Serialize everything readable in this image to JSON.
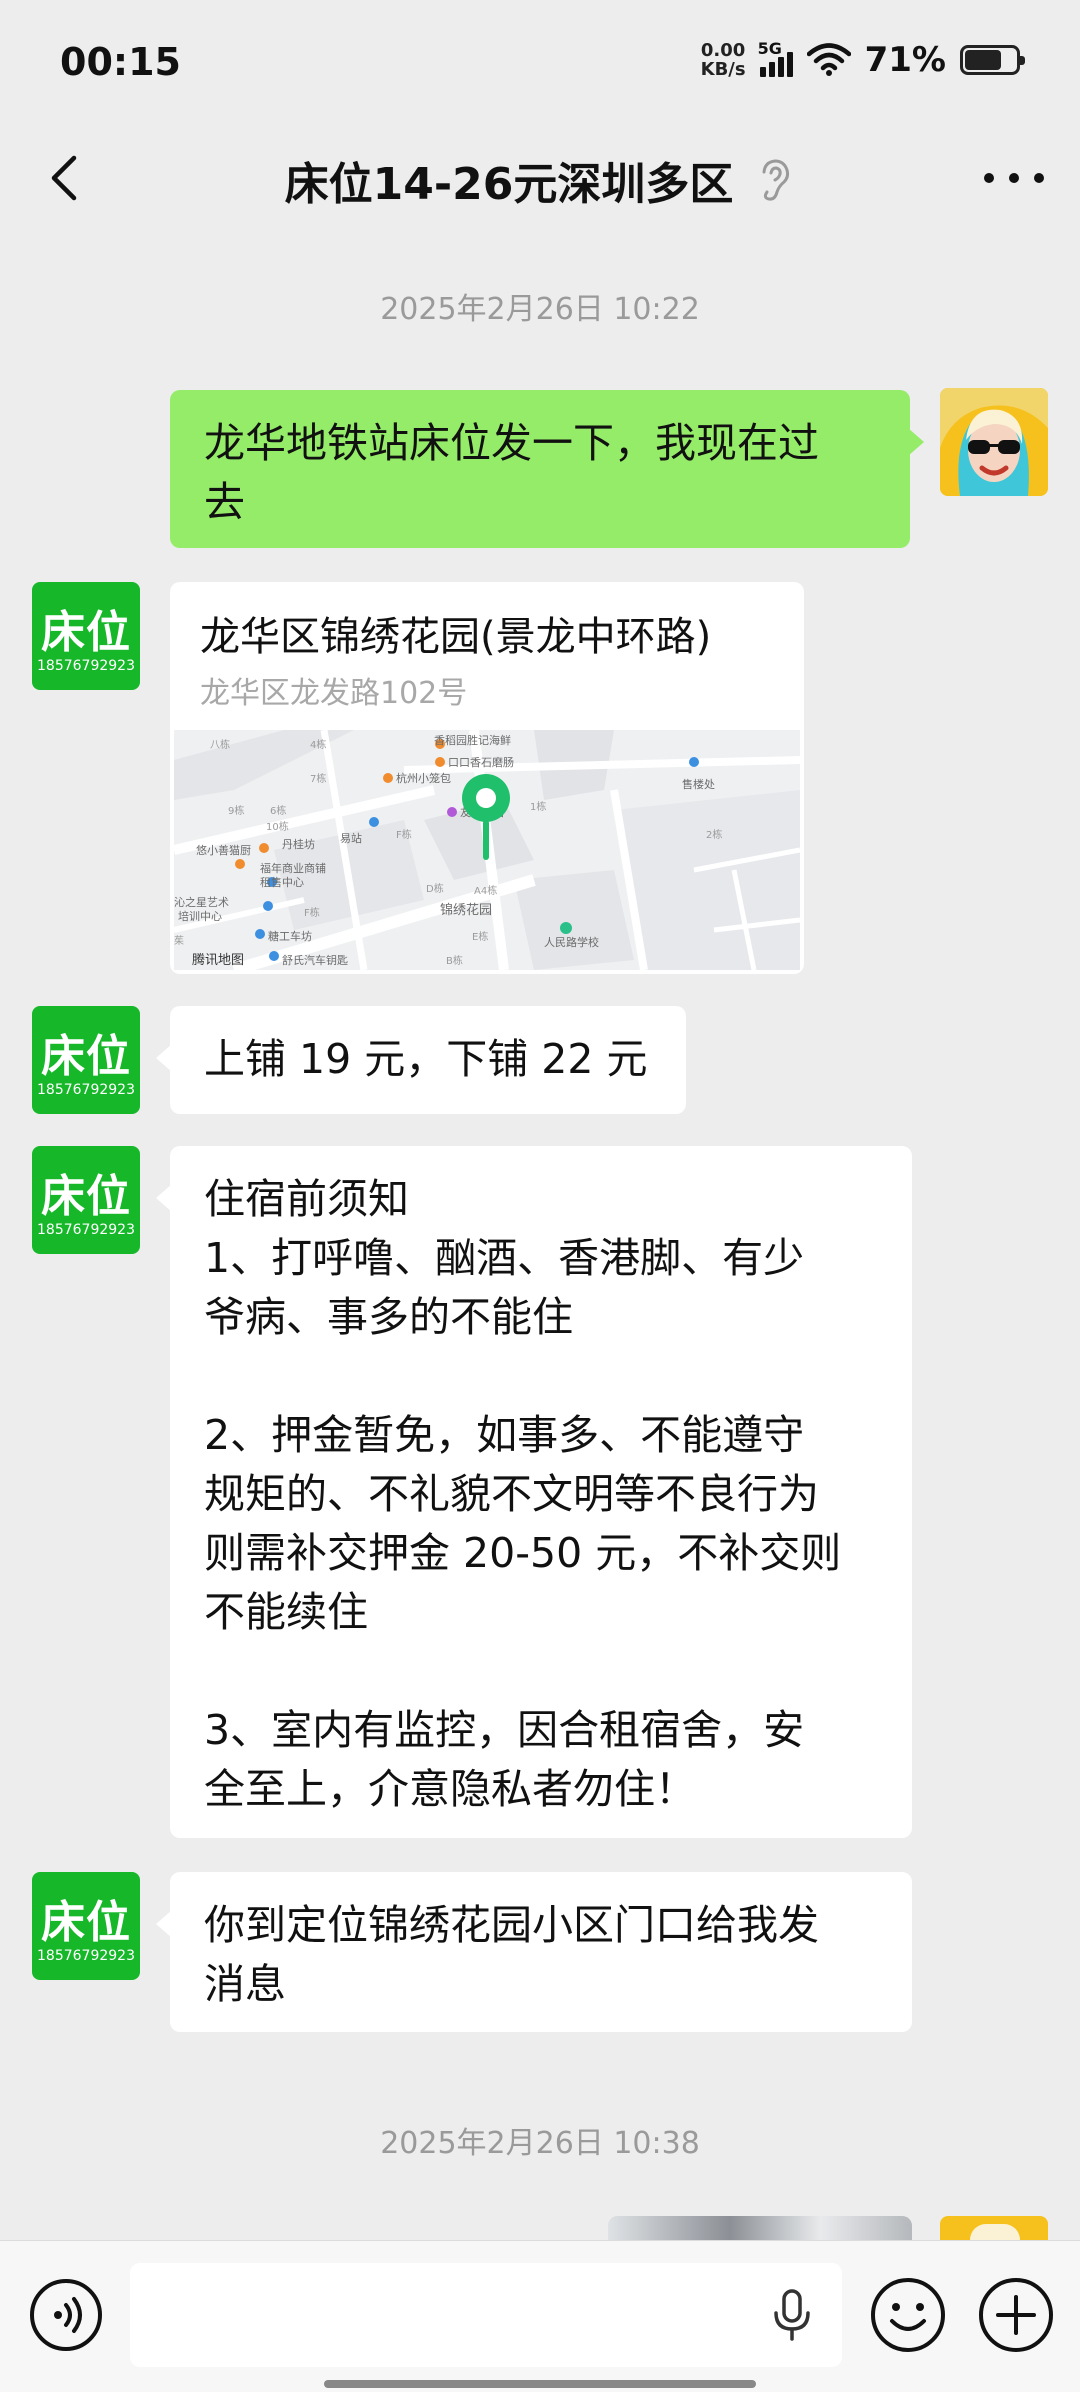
{
  "status_bar": {
    "time": "00:15",
    "net_speed_value": "0.00",
    "net_speed_unit": "KB/s",
    "network": "5G",
    "battery": "71%",
    "battery_level": 0.71
  },
  "header": {
    "title": "床位14-26元深圳多区"
  },
  "messages": {
    "timestamp_1": "2025年2月26日 10:22",
    "out_1": "龙华地铁站床位发一下，我现在过\n去",
    "contact_avatar_label": "床位",
    "contact_avatar_phone": "18576792923",
    "location_name": "龙华区锦绣花园(景龙中环路)",
    "location_address": "龙华区龙发路102号",
    "map_labels": {
      "l1": "香稻园胜记海鲜",
      "l2": "口口香石磨肠",
      "l3": "杭州小笼包",
      "l4": "友佳宾馆",
      "l5": "易站",
      "l6": "丹桂坊",
      "l7": "悠小善猫厨",
      "l8": "福年商业商铺",
      "l9": "租售中心",
      "l10": "沁之星艺术",
      "l11": "培训中心",
      "l12": "糖工车坊",
      "l13": "舒氏汽车钥匙",
      "l14": "锦绣花园",
      "l15": "人民路学校",
      "l16": "售楼处",
      "l17": "腾讯地图",
      "b1": "八栋",
      "b2": "4栋",
      "b3": "7栋",
      "b4": "6栋",
      "b5": "9栋",
      "b6": "10栋",
      "b7": "F栋",
      "b8": "D栋",
      "b9": "A4栋",
      "b10": "E栋",
      "b11": "1栋",
      "b12": "2栋",
      "b13": "B栋",
      "b14": "F栋",
      "b15": "茱"
    },
    "in_price": "上铺 19 元，下铺 22 元",
    "in_notice": "住宿前须知\n1、打呼噜、酗酒、香港脚、有少\n爷病、事多的不能住\n\n2、押金暂免，如事多、不能遵守\n规矩的、不礼貌不文明等不良行为\n则需补交押金 20-50 元，不补交则\n不能续住\n\n3、室内有监控，因合租宿舍，安\n全至上，介意隐私者勿住！",
    "in_arrive": "你到定位锦绣花园小区门口给我发\n消息",
    "timestamp_2": "2025年2月26日 10:38"
  },
  "colors": {
    "background": "#ededed",
    "out_bubble": "#95ec69",
    "contact_avatar": "#16b82a",
    "map_pin": "#1fbf6b"
  }
}
